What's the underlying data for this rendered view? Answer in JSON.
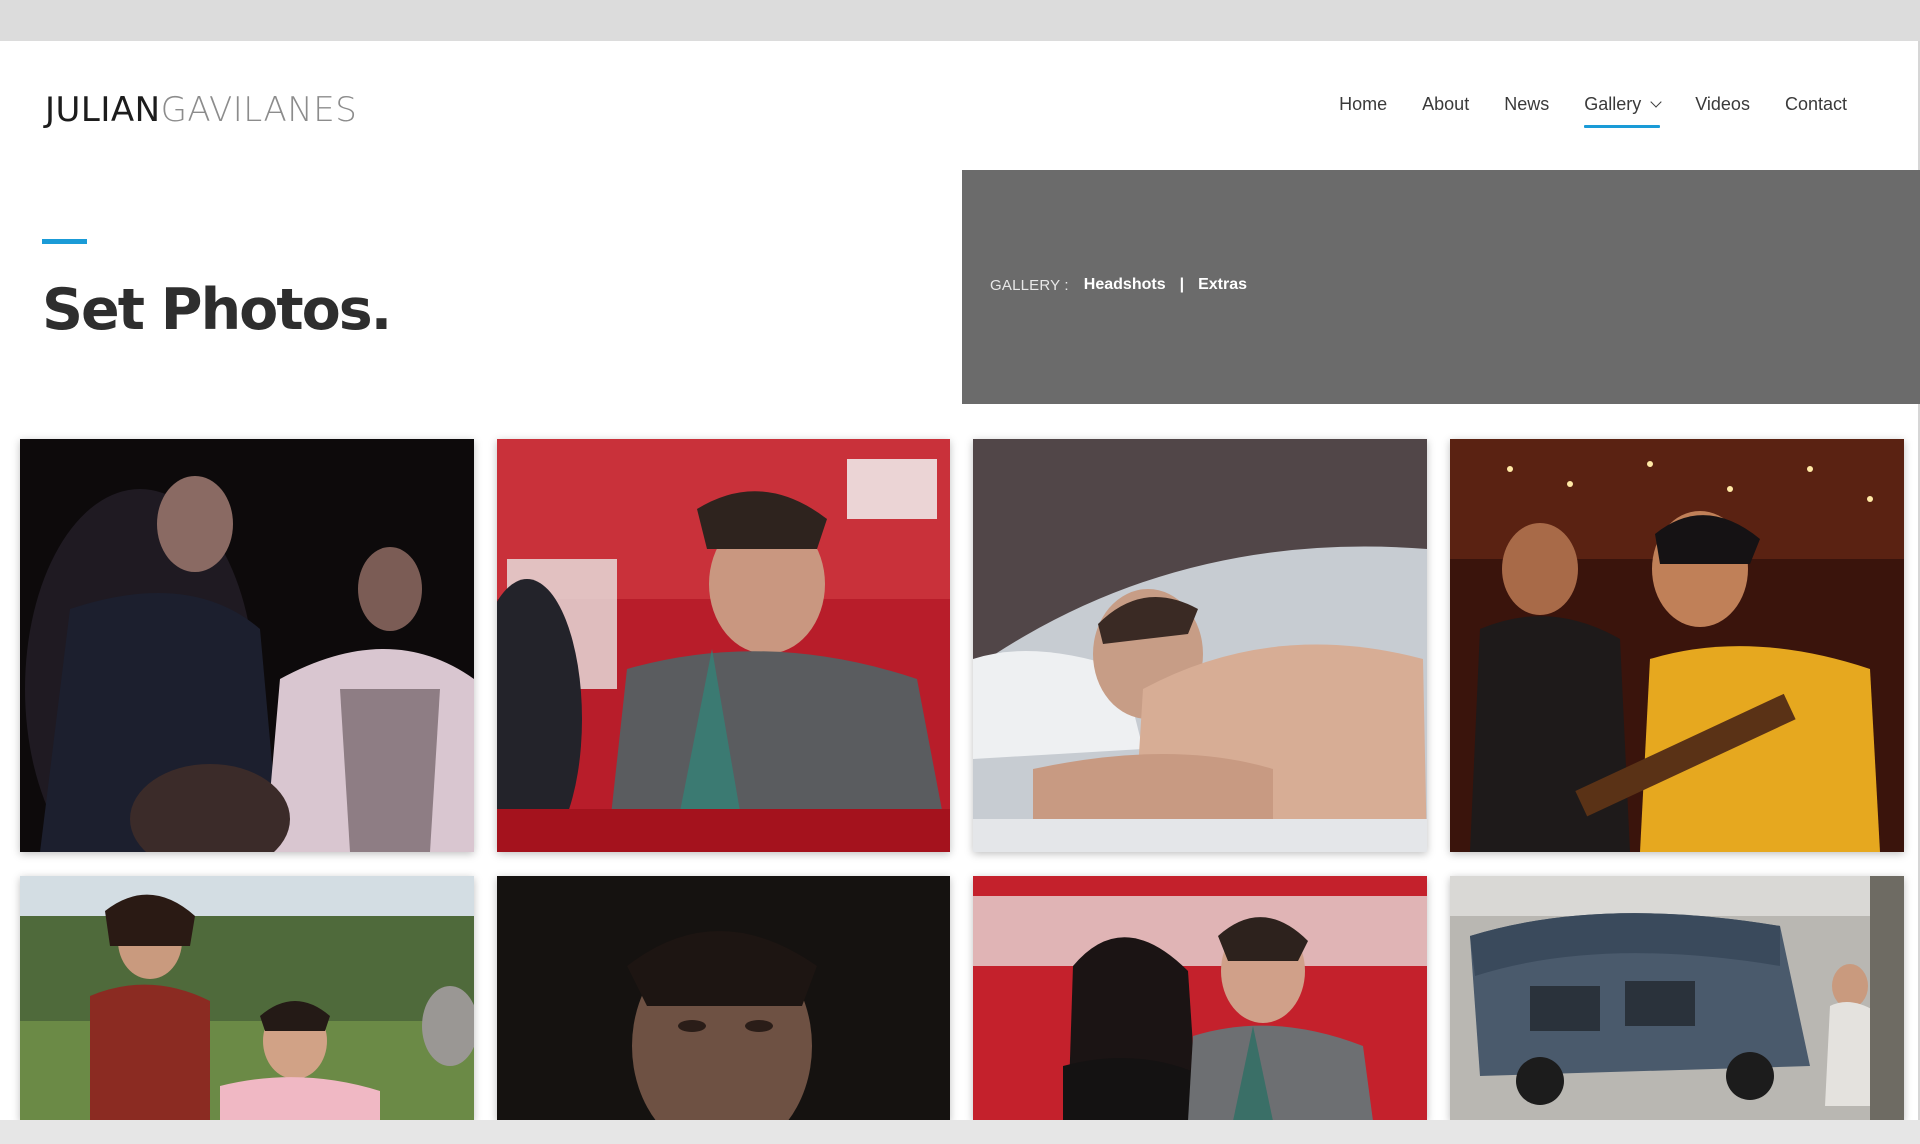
{
  "site": {
    "logo_first": "JULIAN",
    "logo_last": "GAVILANES"
  },
  "nav": {
    "items": [
      {
        "label": "Home",
        "active": false
      },
      {
        "label": "About",
        "active": false
      },
      {
        "label": "News",
        "active": false
      },
      {
        "label": "Gallery",
        "active": true,
        "has_dropdown": true
      },
      {
        "label": "Videos",
        "active": false
      },
      {
        "label": "Contact",
        "active": false
      }
    ]
  },
  "page": {
    "title": "Set Photos."
  },
  "gallery_banner": {
    "label": "GALLERY :",
    "links": [
      "Headshots",
      "Extras"
    ],
    "separator": "|"
  },
  "photos": [
    {
      "scene": "two actors in dark costumes, one in white fur coat"
    },
    {
      "scene": "man in grey suit and scarf at red carpet event"
    },
    {
      "scene": "shirtless man lying on white bed"
    },
    {
      "scene": "musicians playing guitar under string lights"
    },
    {
      "scene": "woman and man sitting on grass in park"
    },
    {
      "scene": "close-up of man in dim light"
    },
    {
      "scene": "couple posing at red carpet backdrop"
    },
    {
      "scene": "people near old blue van"
    }
  ],
  "colors": {
    "accent": "#1a9bd7",
    "banner": "#6b6b6b",
    "title": "#2e2e2e"
  }
}
